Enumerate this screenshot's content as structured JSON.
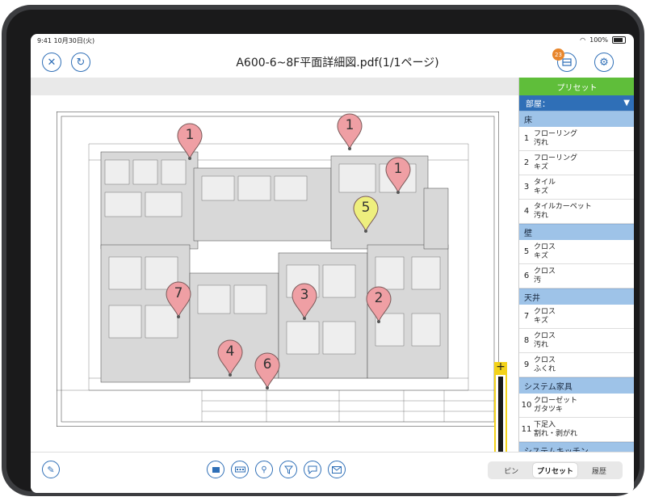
{
  "status": {
    "time": "9:41",
    "date": "10月30日(火)",
    "battery": "100%"
  },
  "header": {
    "title": "A600-6~8F平面詳細図.pdf(1/1ページ)",
    "badge_count": "23"
  },
  "pins": [
    {
      "label": "1",
      "color": "pink"
    },
    {
      "label": "1",
      "color": "pink"
    },
    {
      "label": "1",
      "color": "pink"
    },
    {
      "label": "5",
      "color": "yellow"
    },
    {
      "label": "7",
      "color": "pink"
    },
    {
      "label": "3",
      "color": "pink"
    },
    {
      "label": "2",
      "color": "pink"
    },
    {
      "label": "4",
      "color": "pink"
    },
    {
      "label": "6",
      "color": "pink"
    }
  ],
  "zoom": {
    "plus": "+",
    "minus": "−"
  },
  "panel": {
    "title": "プリセット",
    "room_label": "部屋：",
    "categories": [
      {
        "name": "床",
        "items": [
          {
            "num": "1",
            "line1": "フローリング",
            "line2": "汚れ"
          },
          {
            "num": "2",
            "line1": "フローリング",
            "line2": "キズ"
          },
          {
            "num": "3",
            "line1": "タイル",
            "line2": "キズ"
          },
          {
            "num": "4",
            "line1": "タイルカーペット",
            "line2": "汚れ"
          }
        ]
      },
      {
        "name": "壁",
        "items": [
          {
            "num": "5",
            "line1": "クロス",
            "line2": "キズ"
          },
          {
            "num": "6",
            "line1": "クロス",
            "line2": "汚"
          }
        ]
      },
      {
        "name": "天井",
        "items": [
          {
            "num": "7",
            "line1": "クロス",
            "line2": "キズ"
          },
          {
            "num": "8",
            "line1": "クロス",
            "line2": "汚れ"
          },
          {
            "num": "9",
            "line1": "クロス",
            "line2": "ふくれ"
          }
        ]
      },
      {
        "name": "システム家具",
        "items": [
          {
            "num": "10",
            "line1": "クローゼット",
            "line2": "ガタツキ"
          },
          {
            "num": "11",
            "line1": "下足入",
            "line2": "割れ・剥がれ"
          }
        ]
      },
      {
        "name": "システムキッチン",
        "items": []
      }
    ]
  },
  "tabs": [
    {
      "label": "ピン",
      "active": false
    },
    {
      "label": "プリセット",
      "active": true
    },
    {
      "label": "履歴",
      "active": false
    }
  ],
  "colors": {
    "accent": "#2f6fb7",
    "panel_header": "#5fbe3a",
    "category": "#9ec3e8",
    "pin_pink": "#ef9fa4",
    "pin_yellow": "#eeef7e",
    "zoom": "#f3d21a"
  }
}
